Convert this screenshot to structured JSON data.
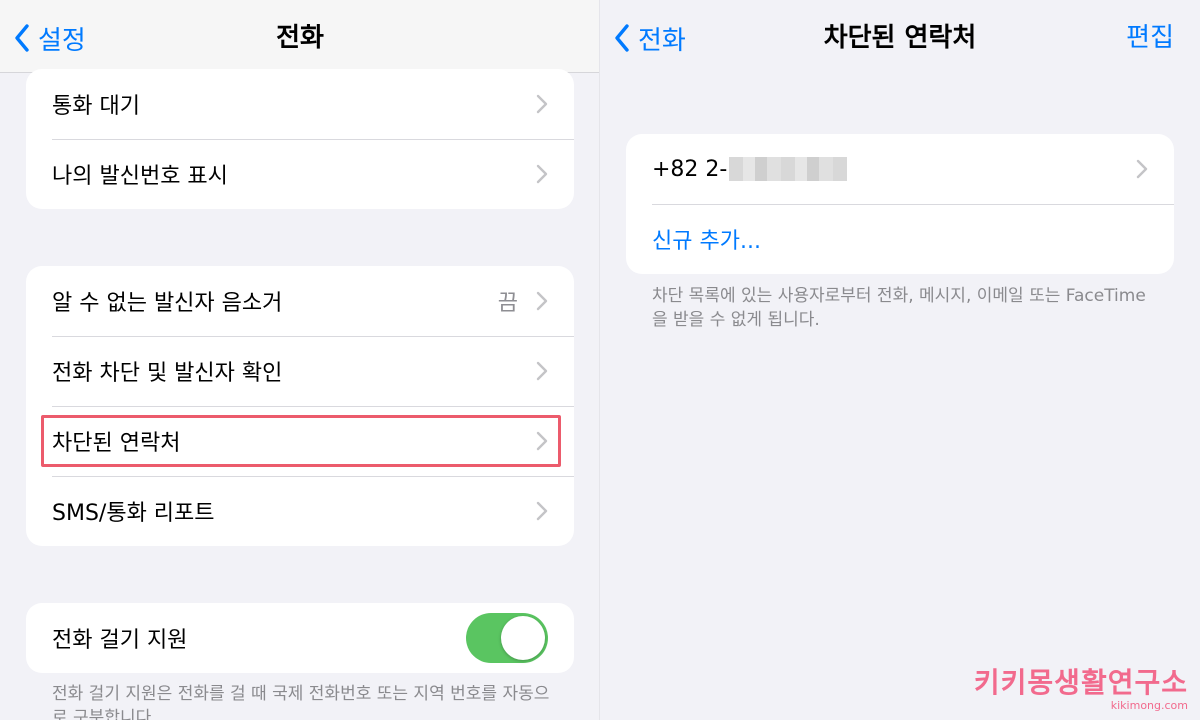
{
  "left": {
    "nav": {
      "back_label": "설정",
      "title": "전화"
    },
    "group1": [
      {
        "label": "통화 대기"
      },
      {
        "label": "나의 발신번호 표시"
      }
    ],
    "group2": [
      {
        "label": "알 수 없는 발신자 음소거",
        "value": "끔"
      },
      {
        "label": "전화 차단 및 발신자 확인"
      },
      {
        "label": "차단된 연락처"
      },
      {
        "label": "SMS/통화 리포트"
      }
    ],
    "group3": {
      "label": "전화 걸기 지원",
      "toggle_on": true
    },
    "footnote": "전화 걸기 지원은 전화를 걸 때 국제 전화번호 또는 지역 번호를 자동으로 구분합니다."
  },
  "right": {
    "nav": {
      "back_label": "전화",
      "title": "차단된 연락처",
      "action_label": "편집"
    },
    "blocked_number": "+82 2-",
    "add_new_label": "신규 추가...",
    "footnote": "차단 목록에 있는 사용자로부터 전화, 메시지, 이메일 또는 FaceTime을 받을 수 없게 됩니다."
  },
  "watermark": {
    "main": "키키몽생활연구소",
    "sub": "kikimong.com"
  },
  "colors": {
    "accent": "#007aff",
    "toggle_on": "#5ac561",
    "highlight": "#ec5b6c",
    "watermark": "#f26a8d"
  },
  "icons": {
    "back": "chevron-left-icon",
    "disclosure": "chevron-right-icon"
  }
}
